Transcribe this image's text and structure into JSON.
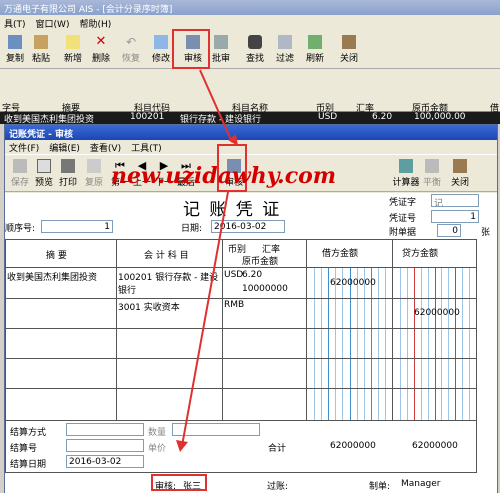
{
  "back": {
    "title": "万通电子有限公司 AIS - [会计分录序时簿]",
    "menu": [
      "具(T)",
      "窗口(W)",
      "帮助(H)"
    ],
    "toolbar": [
      "复制",
      "粘贴",
      "新增",
      "删除",
      "恢复",
      "修改",
      "审核",
      "批审",
      "查找",
      "过滤",
      "刷新",
      "关闭"
    ],
    "grid_headers": [
      "字号",
      "摘要",
      "科目代码",
      "科目名称",
      "币别",
      "汇率",
      "原币金额",
      "借"
    ],
    "grid_row": [
      "",
      "收到美国杰利集团投资",
      "100201",
      "银行存款 - 建设银行",
      "USD",
      "6.20",
      "100,000.00",
      ""
    ]
  },
  "win": {
    "title": "记账凭证 - 审核",
    "menu": [
      "文件(F)",
      "编辑(E)",
      "查看(V)",
      "工具(T)"
    ],
    "toolbar": [
      "保存",
      "预览",
      "打印",
      "复原",
      "第一",
      "上一",
      "下一",
      "最后",
      "审核",
      "",
      "",
      "",
      "计算器",
      "平衡",
      "关闭"
    ]
  },
  "watermark": "new.uzidawhy.com",
  "voucher": {
    "title": "记 账 凭 证",
    "seq_label": "顺序号:",
    "seq_value": "1",
    "date_label": "日期:",
    "date_value": "2016-03-02",
    "type_label": "凭证字",
    "type_value": "记",
    "number_label": "凭证号",
    "number_value": "1",
    "attach_label": "附单据",
    "attach_value": "0",
    "attach_unit": "张",
    "headers": {
      "summary": "摘 要",
      "account": "会 计 科 目",
      "currency": "币别",
      "rate": "汇率",
      "orig": "原币金额",
      "debit": "借方金额",
      "credit": "贷方金额"
    },
    "rows": [
      {
        "summary": "收到美国杰利集团投资",
        "account": "100201 银行存款 - 建设银行",
        "currency": "USD",
        "rate": "6.20",
        "orig": "10000000",
        "debit": "62000000",
        "credit": ""
      },
      {
        "summary": "",
        "account": "3001 实收资本",
        "currency": "RMB",
        "rate": "",
        "orig": "",
        "debit": "",
        "credit": "62000000"
      }
    ],
    "settle_method_label": "结算方式",
    "settle_no_label": "结算号",
    "settle_date_label": "结算日期",
    "settle_date_value": "2016-03-02",
    "qty_label": "数量",
    "price_label": "单价",
    "total_label": "合计",
    "total_debit": "62000000",
    "total_credit": "62000000",
    "auditor_label": "审核:",
    "auditor_value": "张三",
    "posted_label": "过账:",
    "maker_label": "制单:",
    "maker_value": "Manager"
  },
  "colors": {
    "highlight": "#e03030",
    "debit_line": "#3d8fd0",
    "credit_line": "#d23b3b"
  }
}
